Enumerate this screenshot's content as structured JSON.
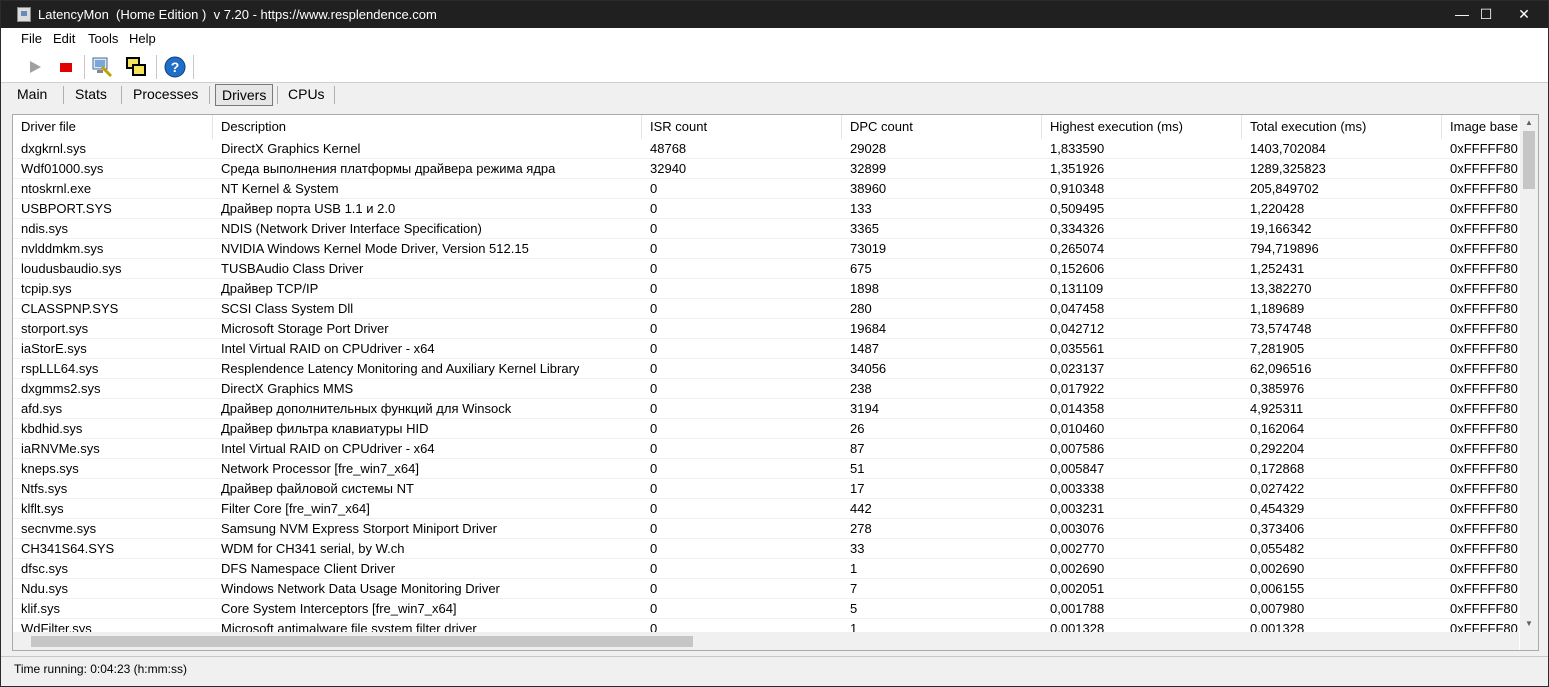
{
  "window": {
    "title": "LatencyMon  (Home Edition )  v 7.20 - https://www.resplendence.com",
    "minimize": "—",
    "maximize": "☐",
    "close": "✕"
  },
  "menu": [
    "File",
    "Edit",
    "Tools",
    "Help"
  ],
  "toolbar": {
    "icons": [
      "play-icon",
      "stop-icon",
      "monitor-search-icon",
      "windows-icon",
      "help-icon"
    ],
    "colors": {
      "stop": "#e00000",
      "help": "#1f6fc9"
    }
  },
  "tabs": [
    {
      "label": "Main"
    },
    {
      "label": "Stats"
    },
    {
      "label": "Processes"
    },
    {
      "label": "Drivers",
      "active": true
    },
    {
      "label": "CPUs"
    }
  ],
  "table": {
    "columns": [
      "Driver file",
      "Description",
      "ISR count",
      "DPC count",
      "Highest execution (ms)",
      "Total execution (ms)",
      "Image base"
    ],
    "rows": [
      [
        "dxgkrnl.sys",
        "DirectX Graphics Kernel",
        "48768",
        "29028",
        "1,833590",
        "1403,702084",
        "0xFFFFF80"
      ],
      [
        "Wdf01000.sys",
        "Среда выполнения платформы драйвера режима ядра",
        "32940",
        "32899",
        "1,351926",
        "1289,325823",
        "0xFFFFF80"
      ],
      [
        "ntoskrnl.exe",
        "NT Kernel & System",
        "0",
        "38960",
        "0,910348",
        "205,849702",
        "0xFFFFF80"
      ],
      [
        "USBPORT.SYS",
        "Драйвер порта USB 1.1 и 2.0",
        "0",
        "133",
        "0,509495",
        "1,220428",
        "0xFFFFF80"
      ],
      [
        "ndis.sys",
        "NDIS (Network Driver Interface Specification)",
        "0",
        "3365",
        "0,334326",
        "19,166342",
        "0xFFFFF80"
      ],
      [
        "nvlddmkm.sys",
        "NVIDIA Windows Kernel Mode Driver, Version 512.15",
        "0",
        "73019",
        "0,265074",
        "794,719896",
        "0xFFFFF80"
      ],
      [
        "loudusbaudio.sys",
        "TUSBAudio Class Driver",
        "0",
        "675",
        "0,152606",
        "1,252431",
        "0xFFFFF80"
      ],
      [
        "tcpip.sys",
        "Драйвер TCP/IP",
        "0",
        "1898",
        "0,131109",
        "13,382270",
        "0xFFFFF80"
      ],
      [
        "CLASSPNP.SYS",
        "SCSI Class System Dll",
        "0",
        "280",
        "0,047458",
        "1,189689",
        "0xFFFFF80"
      ],
      [
        "storport.sys",
        "Microsoft Storage Port Driver",
        "0",
        "19684",
        "0,042712",
        "73,574748",
        "0xFFFFF80"
      ],
      [
        "iaStorE.sys",
        "Intel Virtual RAID on CPUdriver - x64",
        "0",
        "1487",
        "0,035561",
        "7,281905",
        "0xFFFFF80"
      ],
      [
        "rspLLL64.sys",
        "Resplendence Latency Monitoring and Auxiliary Kernel Library",
        "0",
        "34056",
        "0,023137",
        "62,096516",
        "0xFFFFF80"
      ],
      [
        "dxgmms2.sys",
        "DirectX Graphics MMS",
        "0",
        "238",
        "0,017922",
        "0,385976",
        "0xFFFFF80"
      ],
      [
        "afd.sys",
        "Драйвер дополнительных функций для Winsock",
        "0",
        "3194",
        "0,014358",
        "4,925311",
        "0xFFFFF80"
      ],
      [
        "kbdhid.sys",
        "Драйвер фильтра клавиатуры HID",
        "0",
        "26",
        "0,010460",
        "0,162064",
        "0xFFFFF80"
      ],
      [
        "iaRNVMe.sys",
        "Intel Virtual RAID on CPUdriver - x64",
        "0",
        "87",
        "0,007586",
        "0,292204",
        "0xFFFFF80"
      ],
      [
        "kneps.sys",
        "Network Processor [fre_win7_x64]",
        "0",
        "51",
        "0,005847",
        "0,172868",
        "0xFFFFF80"
      ],
      [
        "Ntfs.sys",
        "Драйвер файловой системы NT",
        "0",
        "17",
        "0,003338",
        "0,027422",
        "0xFFFFF80"
      ],
      [
        "klflt.sys",
        "Filter Core [fre_win7_x64]",
        "0",
        "442",
        "0,003231",
        "0,454329",
        "0xFFFFF80"
      ],
      [
        "secnvme.sys",
        "Samsung NVM Express Storport Miniport Driver",
        "0",
        "278",
        "0,003076",
        "0,373406",
        "0xFFFFF80"
      ],
      [
        "CH341S64.SYS",
        "WDM for CH341 serial, by W.ch",
        "0",
        "33",
        "0,002770",
        "0,055482",
        "0xFFFFF80"
      ],
      [
        "dfsc.sys",
        "DFS Namespace Client Driver",
        "0",
        "1",
        "0,002690",
        "0,002690",
        "0xFFFFF80"
      ],
      [
        "Ndu.sys",
        "Windows Network Data Usage Monitoring Driver",
        "0",
        "7",
        "0,002051",
        "0,006155",
        "0xFFFFF80"
      ],
      [
        "klif.sys",
        "Core System Interceptors [fre_win7_x64]",
        "0",
        "5",
        "0,001788",
        "0,007980",
        "0xFFFFF80"
      ],
      [
        "WdFilter.sys",
        "Microsoft antimalware file system filter driver",
        "0",
        "1",
        "0,001328",
        "0,001328",
        "0xFFFFF80"
      ]
    ]
  },
  "status": "Time running: 0:04:23  (h:mm:ss)"
}
